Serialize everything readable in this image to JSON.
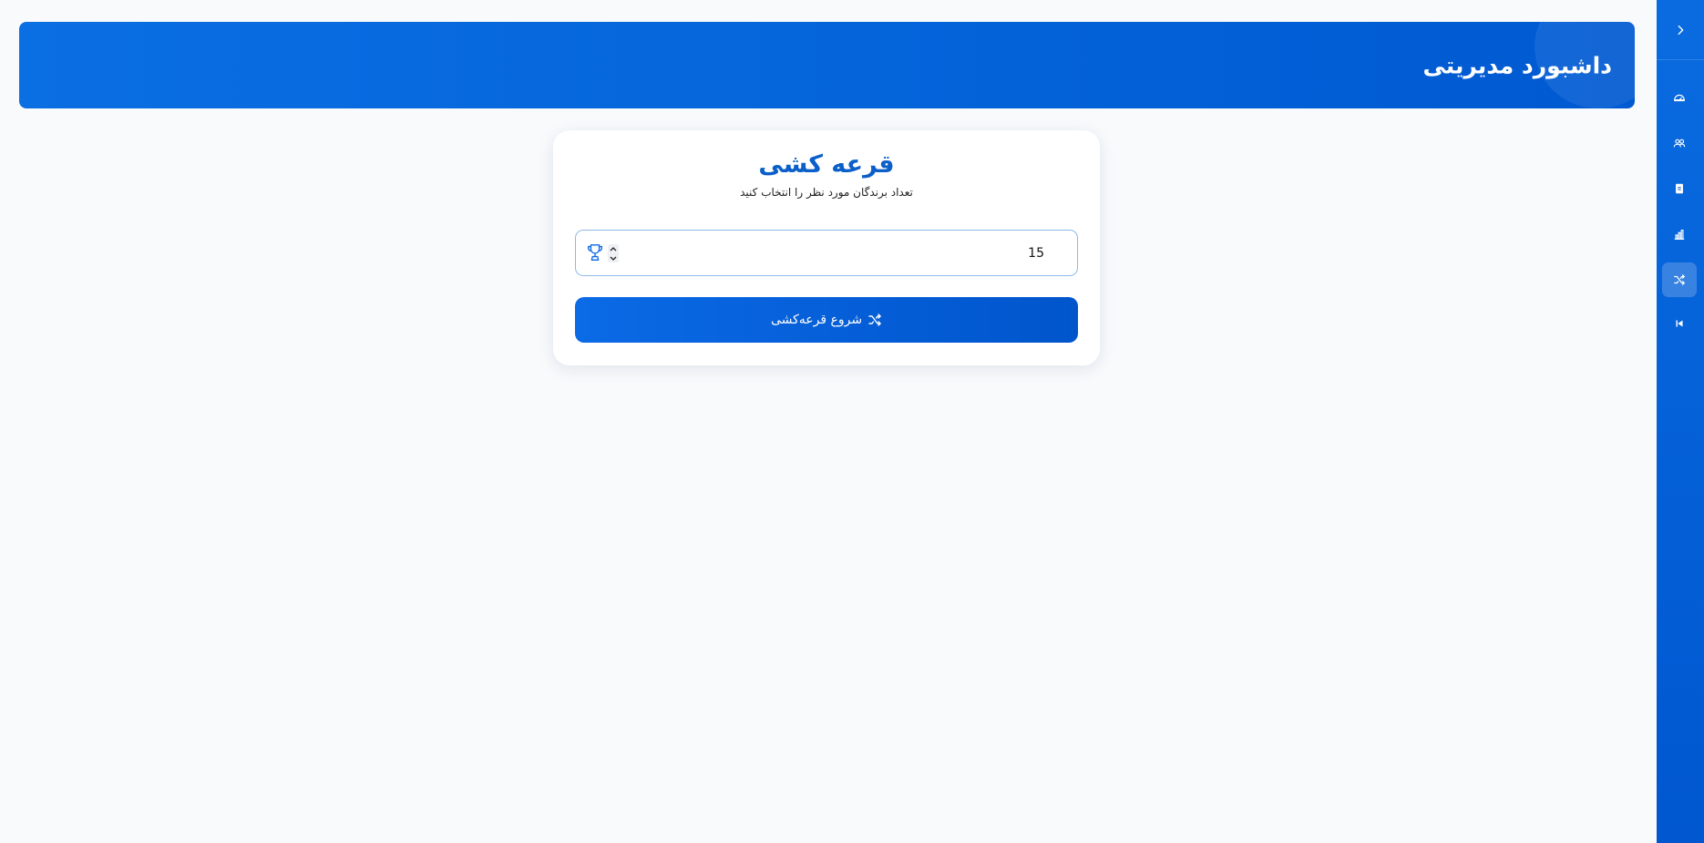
{
  "header": {
    "title": "داشبورد مدیریتی"
  },
  "sidebar": {
    "toggle_icon": "chevron-right-icon",
    "items": [
      {
        "icon": "speedometer-icon",
        "active": false
      },
      {
        "icon": "users-icon",
        "active": false
      },
      {
        "icon": "document-icon",
        "active": false
      },
      {
        "icon": "bar-chart-icon",
        "active": false
      },
      {
        "icon": "shuffle-icon",
        "active": true
      },
      {
        "icon": "skip-back-icon",
        "active": false
      }
    ]
  },
  "lottery": {
    "title": "قرعه کشی",
    "subtitle": "تعداد برندگان مورد نظر را انتخاب کنید",
    "winners_input": {
      "value": "15",
      "icon": "trophy-icon"
    },
    "start_button_label": "شروع قرعه‌کشی",
    "start_button_icon": "shuffle-icon"
  },
  "colors": {
    "primary": "#0b6ae6",
    "primary_dark": "#0055cc",
    "title_blue": "#0b5fc9",
    "background": "#f8fafc",
    "input_border": "#8db9e6"
  }
}
